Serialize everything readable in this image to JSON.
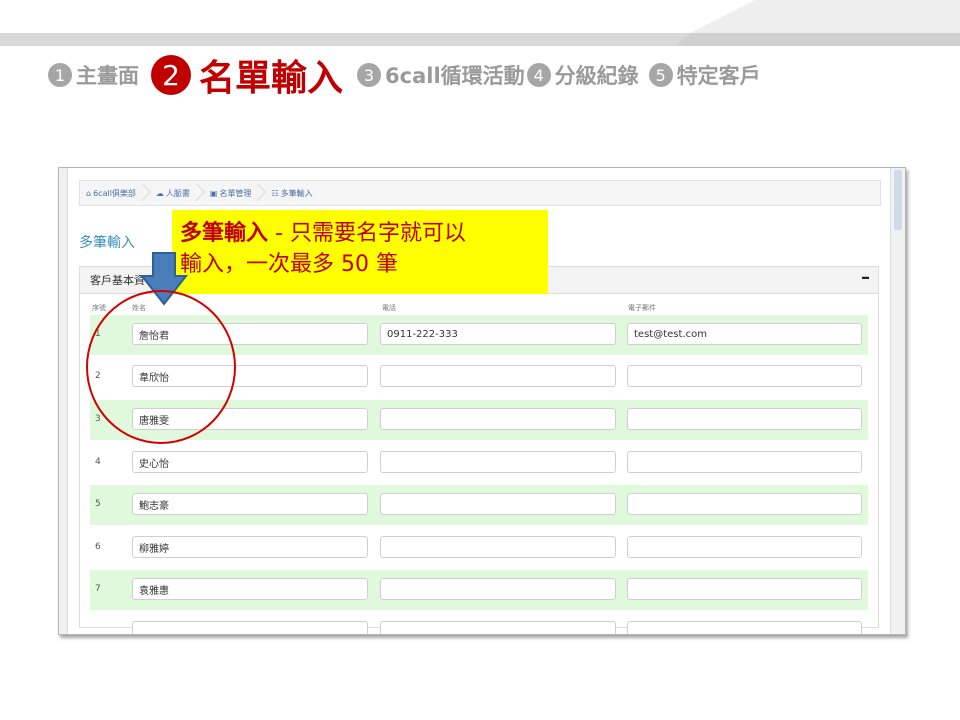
{
  "steps": [
    {
      "num": "1",
      "label": "主畫面",
      "active": false
    },
    {
      "num": "2",
      "label": "名單輸入",
      "active": true
    },
    {
      "num": "3",
      "label": "6call循環活動",
      "active": false
    },
    {
      "num": "4",
      "label": "分級紀錄",
      "active": false
    },
    {
      "num": "5",
      "label": "特定客戶",
      "active": false
    }
  ],
  "breadcrumb": [
    "6call俱樂部",
    "人脈書",
    "名單管理",
    "多筆輸入"
  ],
  "page_title": "多筆輸入",
  "panel": {
    "title": "客戶基本資",
    "collapse": "–",
    "headers": {
      "no": "序號",
      "name": "姓名",
      "phone": "電話",
      "email": "電子郵件"
    }
  },
  "rows": [
    {
      "no": "1",
      "name": "詹怡君",
      "phone": "0911-222-333",
      "email": "test@test.com"
    },
    {
      "no": "2",
      "name": "韋欣怡",
      "phone": "",
      "email": ""
    },
    {
      "no": "3",
      "name": "唐雅雯",
      "phone": "",
      "email": ""
    },
    {
      "no": "4",
      "name": "史心怡",
      "phone": "",
      "email": ""
    },
    {
      "no": "5",
      "name": "鮑志豪",
      "phone": "",
      "email": ""
    },
    {
      "no": "6",
      "name": "柳雅婷",
      "phone": "",
      "email": ""
    },
    {
      "no": "7",
      "name": "袁雅惠",
      "phone": "",
      "email": ""
    }
  ],
  "callout": {
    "line1_strong": "多筆輸入",
    "line1_rest": " - 只需要名字就可以",
    "line2": "輸入，一次最多 50 筆"
  },
  "colors": {
    "accent_red": "#c00000",
    "highlight": "#ffff00",
    "row_green": "#e0f8dc",
    "arrow_blue": "#4a7ebb"
  }
}
